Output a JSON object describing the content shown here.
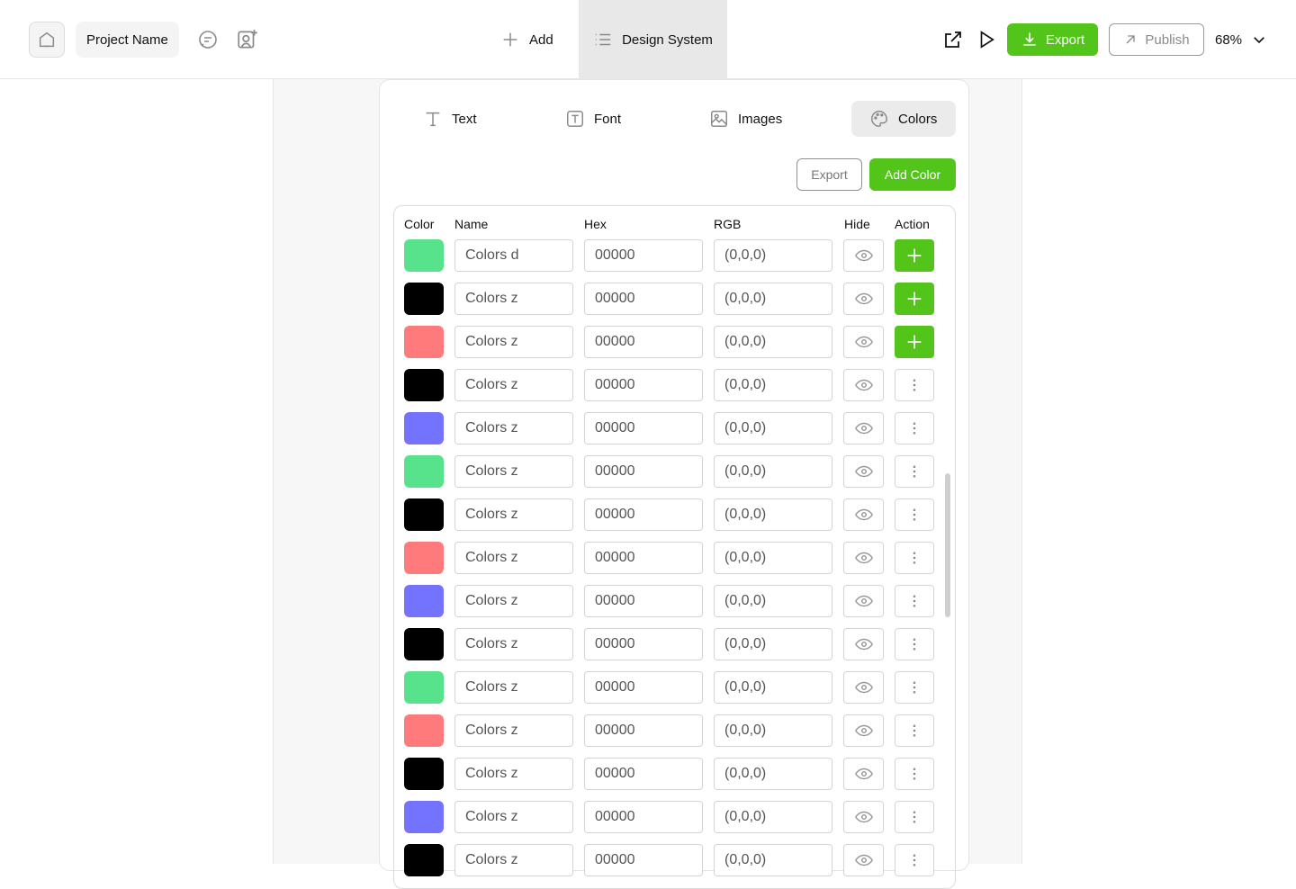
{
  "header": {
    "project_name": "Project Name",
    "add_label": "Add",
    "design_system_label": "Design System",
    "export_label": "Export",
    "publish_label": "Publish",
    "zoom": "68%"
  },
  "tabs": [
    {
      "label": "Text",
      "icon": "text-icon"
    },
    {
      "label": "Font",
      "icon": "font-icon"
    },
    {
      "label": "Images",
      "icon": "image-icon"
    },
    {
      "label": "Colors",
      "icon": "palette-icon",
      "active": true
    }
  ],
  "toolbar": {
    "export_label": "Export",
    "add_color_label": "Add Color"
  },
  "table": {
    "headers": [
      "Color",
      "Name",
      "Hex",
      "RGB",
      "Hide",
      "Action"
    ],
    "rows": [
      {
        "color": "#57e38b",
        "name": "Colors d",
        "hex": "00000",
        "rgb": "(0,0,0)",
        "action": "add"
      },
      {
        "color": "#000000",
        "name": "Colors z",
        "hex": "00000",
        "rgb": "(0,0,0)",
        "action": "add"
      },
      {
        "color": "#ff7b7b",
        "name": "Colors z",
        "hex": "00000",
        "rgb": "(0,0,0)",
        "action": "add"
      },
      {
        "color": "#000000",
        "name": "Colors z",
        "hex": "00000",
        "rgb": "(0,0,0)",
        "action": "more"
      },
      {
        "color": "#7373ff",
        "name": "Colors z",
        "hex": "00000",
        "rgb": "(0,0,0)",
        "action": "more"
      },
      {
        "color": "#57e38b",
        "name": "Colors z",
        "hex": "00000",
        "rgb": "(0,0,0)",
        "action": "more"
      },
      {
        "color": "#000000",
        "name": "Colors z",
        "hex": "00000",
        "rgb": "(0,0,0)",
        "action": "more"
      },
      {
        "color": "#ff7b7b",
        "name": "Colors z",
        "hex": "00000",
        "rgb": "(0,0,0)",
        "action": "more"
      },
      {
        "color": "#7373ff",
        "name": "Colors z",
        "hex": "00000",
        "rgb": "(0,0,0)",
        "action": "more"
      },
      {
        "color": "#000000",
        "name": "Colors z",
        "hex": "00000",
        "rgb": "(0,0,0)",
        "action": "more"
      },
      {
        "color": "#57e38b",
        "name": "Colors z",
        "hex": "00000",
        "rgb": "(0,0,0)",
        "action": "more"
      },
      {
        "color": "#ff7b7b",
        "name": "Colors z",
        "hex": "00000",
        "rgb": "(0,0,0)",
        "action": "more"
      },
      {
        "color": "#000000",
        "name": "Colors z",
        "hex": "00000",
        "rgb": "(0,0,0)",
        "action": "more"
      },
      {
        "color": "#7373ff",
        "name": "Colors z",
        "hex": "00000",
        "rgb": "(0,0,0)",
        "action": "more"
      },
      {
        "color": "#000000",
        "name": "Colors z",
        "hex": "00000",
        "rgb": "(0,0,0)",
        "action": "more"
      }
    ]
  },
  "colors": {
    "accent": "#52c41a",
    "border": "#d4d4d4"
  }
}
